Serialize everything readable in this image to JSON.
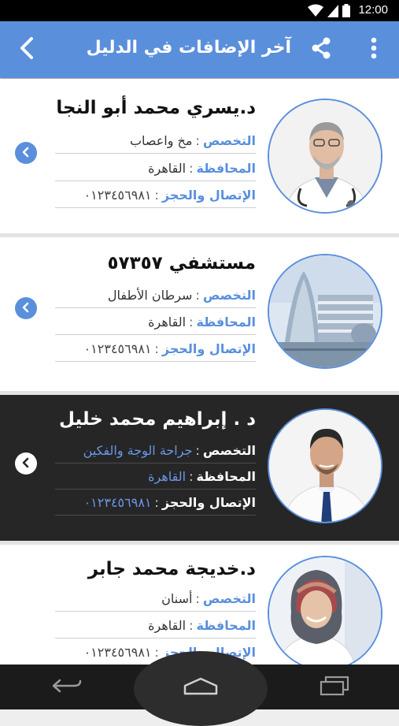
{
  "status_bar": {
    "time": "12:00"
  },
  "app_bar": {
    "title": "آخر الإضافات في الدليل"
  },
  "labels": {
    "specialty": "التخصص",
    "governorate": "المحافظة",
    "contact": "الإتصال والحجز",
    "colon": ":"
  },
  "listings": [
    {
      "name": "د.يسري  محمد أبو النجا",
      "specialty": "مخ واعصاب",
      "governorate": "القاهرة",
      "phone": "٠١٢٣٤٥٦٩٨١",
      "selected": false
    },
    {
      "name": "مستشفي  ٥٧٣٥٧",
      "specialty": "سرطان الأطفال",
      "governorate": "القاهرة",
      "phone": "٠١٢٣٤٥٦٩٨١",
      "selected": false
    },
    {
      "name": "د . إبراهيم محمد خليل",
      "specialty": "جراحة الوجة والفكين",
      "governorate": "القاهرة",
      "phone": "٠١٢٣٤٥٦٩٨١",
      "selected": true
    },
    {
      "name": "د.خديجة محمد جابر",
      "specialty": "أسنان",
      "governorate": "القاهرة",
      "phone": "٠١٢٣٤٥٦٩٨١",
      "selected": false
    }
  ],
  "colors": {
    "accent": "#5a8fdc",
    "selected_bg": "#262626"
  }
}
